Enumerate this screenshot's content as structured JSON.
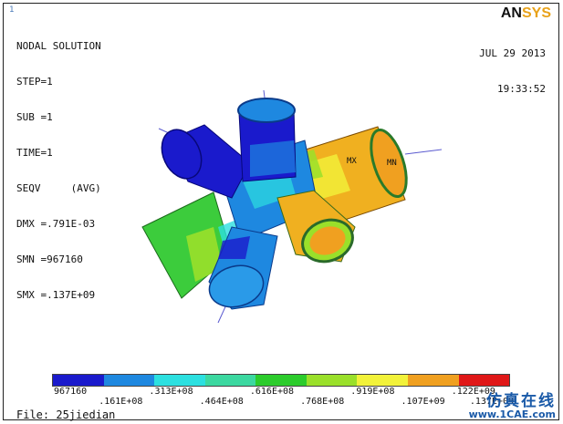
{
  "corner_index": "1",
  "header": {
    "title": "NODAL SOLUTION",
    "lines": [
      "STEP=1",
      "SUB =1",
      "TIME=1",
      "SEQV     (AVG)",
      "DMX =.791E-03",
      "SMN =967160",
      "SMX =.137E+09"
    ]
  },
  "brand": {
    "prefix": "AN",
    "accent": "SYS"
  },
  "datetime": {
    "date": "JUL 29 2013",
    "time": "19:33:52"
  },
  "model_labels": {
    "mx": "MX",
    "mn": "MN"
  },
  "legend": {
    "colors": [
      "#1a1acc",
      "#1e88e0",
      "#2ce0e0",
      "#3cd8a0",
      "#2ccc2c",
      "#9ae02a",
      "#f2f23a",
      "#f0a020",
      "#e01818"
    ],
    "top_labels": [
      "967160",
      ".313E+08",
      ".616E+08",
      ".919E+08",
      ".122E+09"
    ],
    "bottom_labels": [
      ".161E+08",
      ".464E+08",
      ".768E+08",
      ".107E+09",
      ".137E+09"
    ]
  },
  "file": {
    "label": "File: 25jiedian"
  },
  "watermark": {
    "cn": "仿真在线",
    "url": "www.1CAE.com"
  }
}
